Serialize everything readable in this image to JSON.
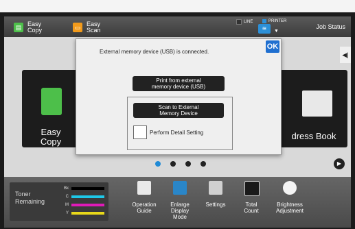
{
  "header": {
    "apps": [
      {
        "label": "Easy\nCopy",
        "icon": "copy-icon",
        "color": "#4dbf4a"
      },
      {
        "label": "Easy\nScan",
        "icon": "scan-icon",
        "color": "#f29a1a"
      }
    ],
    "status_line": "LINE",
    "status_printer": "PRINTER",
    "job_status": "Job Status"
  },
  "tiles": [
    {
      "label": "Easy\nCopy"
    },
    {
      "label": "dress Book"
    }
  ],
  "toner": {
    "title": "Toner\nRemaining",
    "rows": [
      {
        "key": "Bk",
        "color": "#000000"
      },
      {
        "key": "C",
        "color": "#1ec8e8"
      },
      {
        "key": "M",
        "color": "#e01ab8"
      },
      {
        "key": "Y",
        "color": "#e8d81a"
      }
    ]
  },
  "bottom_items": [
    {
      "label": "Operation\nGuide",
      "icon": "help-icon"
    },
    {
      "label": "Enlarge\nDisplay\nMode",
      "icon": "enlarge-icon"
    },
    {
      "label": "Settings",
      "icon": "settings-icon"
    },
    {
      "label": "Total\nCount",
      "icon": "counter-icon"
    },
    {
      "label": "Brightness\nAdjustment",
      "icon": "brightness-icon"
    }
  ],
  "dialog": {
    "message": "External memory device (USB) is connected.",
    "ok_label": "OK",
    "print_label": "Print from external\nmemory device (USB)",
    "scan_label": "Scan to External\nMemory Device",
    "detail_label": "Perform Detail Setting"
  },
  "colors": {
    "accent": "#1f6fd0",
    "active_dot": "#1f8ad6"
  }
}
